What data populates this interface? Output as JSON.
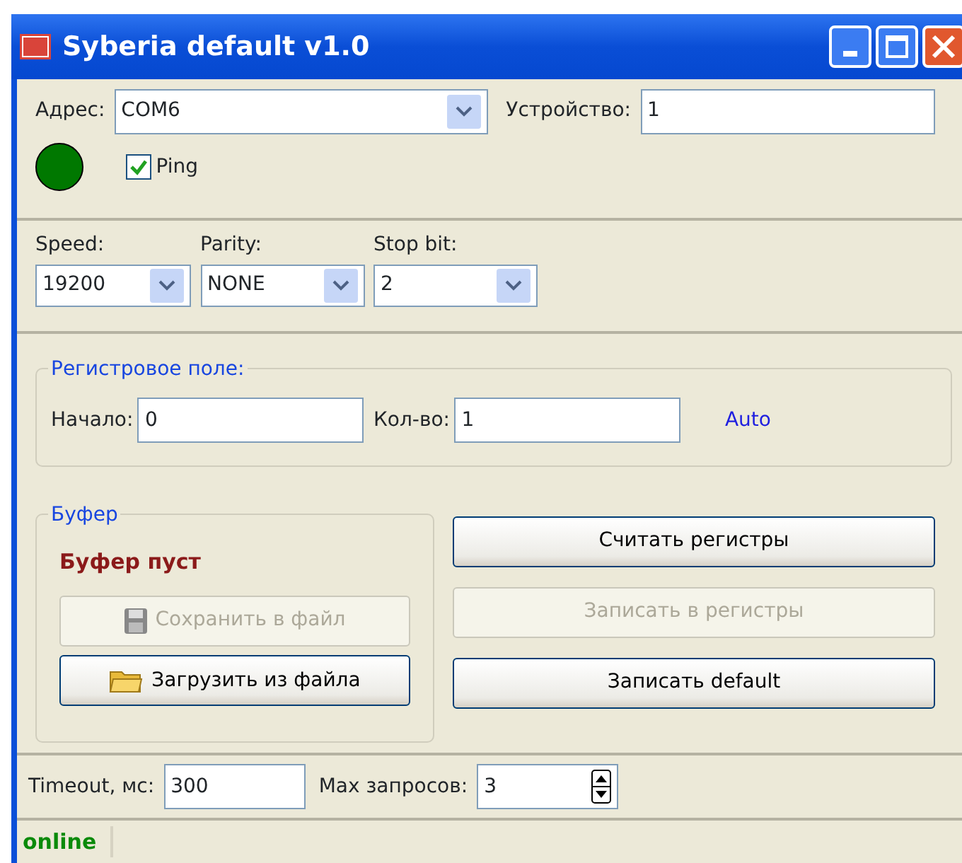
{
  "window": {
    "title": "Syberia default v1.0"
  },
  "connection": {
    "address_label": "Адрес:",
    "address": "COM6",
    "device_label": "Устройство:",
    "device": "1",
    "connected": true,
    "ping": {
      "label": "Ping",
      "checked": true
    }
  },
  "serial": [
    {
      "label": "Speed:",
      "value": "19200"
    },
    {
      "label": "Parity:",
      "value": "NONE"
    },
    {
      "label": "Stop bit:",
      "value": "2"
    }
  ],
  "register_field": {
    "legend": "Регистровое поле:",
    "start_label": "Начало:",
    "start": "0",
    "count_label": "Кол-во:",
    "count": "1",
    "auto": "Auto"
  },
  "buffer": {
    "legend": "Буфер",
    "status": "Буфер пуст",
    "buttons": [
      {
        "label": "Сохранить в файл",
        "kind": "save",
        "disabled": true
      },
      {
        "label": "Загрузить из файла",
        "kind": "load",
        "disabled": false
      }
    ]
  },
  "actions": [
    {
      "label": "Считать регистры",
      "disabled": false
    },
    {
      "label": "Записать в регистры",
      "disabled": true
    },
    {
      "label": "Записать default",
      "disabled": false
    }
  ],
  "timeout": {
    "label": "Timeout, мс:",
    "value": "300",
    "max_label": "Max запросов:",
    "max": "3"
  },
  "status_bar": {
    "text": "online"
  }
}
